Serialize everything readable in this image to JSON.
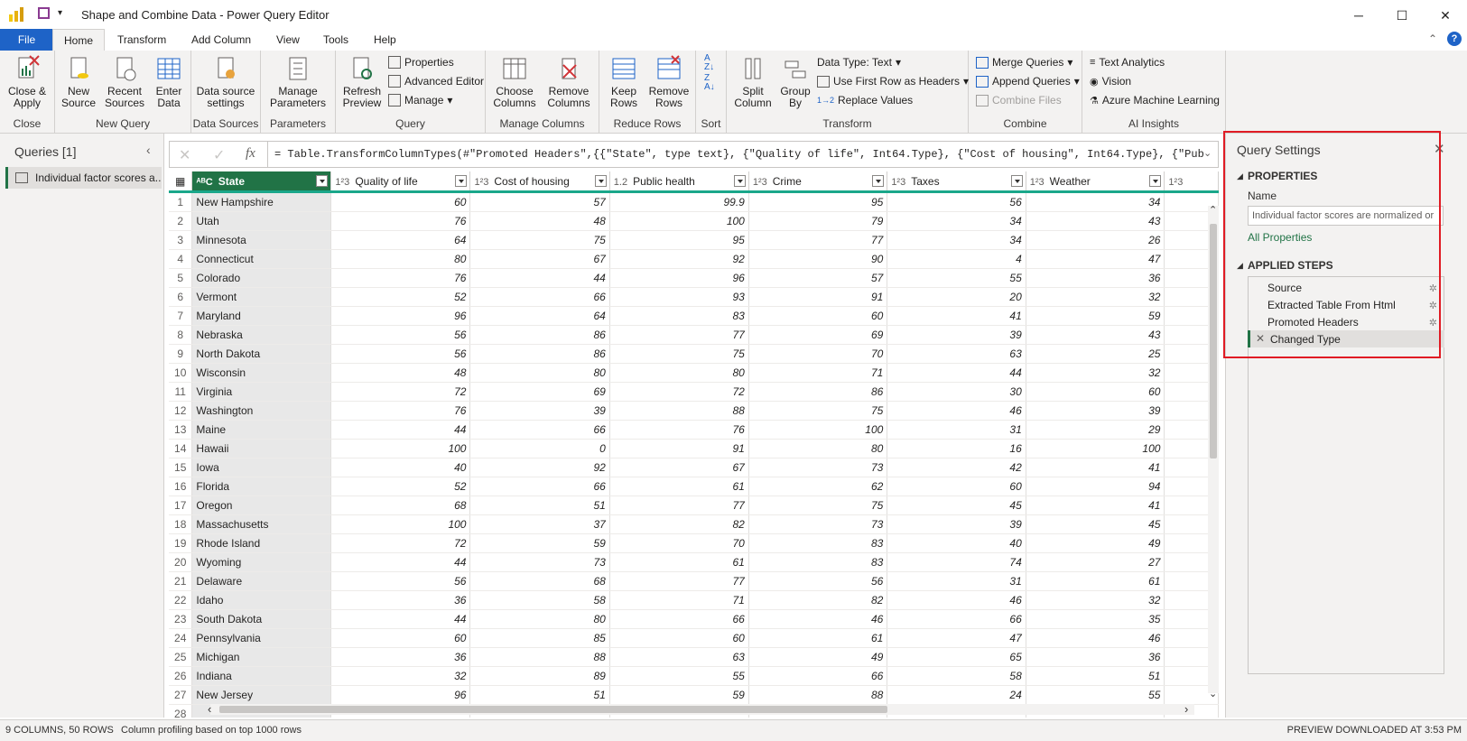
{
  "window": {
    "title": "Shape and Combine Data - Power Query Editor"
  },
  "tabs": [
    "File",
    "Home",
    "Transform",
    "Add Column",
    "View",
    "Tools",
    "Help"
  ],
  "ribbon": {
    "close_apply": "Close &\nApply",
    "close_group": "Close",
    "new_source": "New\nSource",
    "recent_sources": "Recent\nSources",
    "enter_data": "Enter\nData",
    "new_query_group": "New Query",
    "data_source_settings": "Data source\nsettings",
    "data_sources_group": "Data Sources",
    "manage_parameters": "Manage\nParameters",
    "parameters_group": "Parameters",
    "refresh_preview": "Refresh\nPreview",
    "properties": "Properties",
    "advanced_editor": "Advanced Editor",
    "manage": "Manage",
    "query_group": "Query",
    "choose_columns": "Choose\nColumns",
    "remove_columns": "Remove\nColumns",
    "manage_columns_group": "Manage Columns",
    "keep_rows": "Keep\nRows",
    "remove_rows": "Remove\nRows",
    "reduce_rows_group": "Reduce Rows",
    "sort_group": "Sort",
    "split_column": "Split\nColumn",
    "group_by": "Group\nBy",
    "data_type": "Data Type: Text",
    "use_first_row": "Use First Row as Headers",
    "replace_values": "Replace Values",
    "transform_group": "Transform",
    "merge_queries": "Merge Queries",
    "append_queries": "Append Queries",
    "combine_files": "Combine Files",
    "combine_group": "Combine",
    "text_analytics": "Text Analytics",
    "vision": "Vision",
    "azure_ml": "Azure Machine Learning",
    "ai_group": "AI Insights"
  },
  "queries": {
    "header": "Queries [1]",
    "items": [
      "Individual factor scores a..."
    ]
  },
  "formula": "= Table.TransformColumnTypes(#\"Promoted Headers\",{{\"State\", type text}, {\"Quality of life\", Int64.Type}, {\"Cost of housing\", Int64.Type}, {\"Public",
  "columns": [
    {
      "type": "ABC",
      "name": "State"
    },
    {
      "type": "123",
      "name": "Quality of life"
    },
    {
      "type": "123",
      "name": "Cost of housing"
    },
    {
      "type": "1.2",
      "name": "Public health"
    },
    {
      "type": "123",
      "name": "Crime"
    },
    {
      "type": "123",
      "name": "Taxes"
    },
    {
      "type": "123",
      "name": "Weather"
    }
  ],
  "rows": [
    [
      "1",
      "New Hampshire",
      "60",
      "57",
      "99.9",
      "95",
      "56",
      "34"
    ],
    [
      "2",
      "Utah",
      "76",
      "48",
      "100",
      "79",
      "34",
      "43"
    ],
    [
      "3",
      "Minnesota",
      "64",
      "75",
      "95",
      "77",
      "34",
      "26"
    ],
    [
      "4",
      "Connecticut",
      "80",
      "67",
      "92",
      "90",
      "4",
      "47"
    ],
    [
      "5",
      "Colorado",
      "76",
      "44",
      "96",
      "57",
      "55",
      "36"
    ],
    [
      "6",
      "Vermont",
      "52",
      "66",
      "93",
      "91",
      "20",
      "32"
    ],
    [
      "7",
      "Maryland",
      "96",
      "64",
      "83",
      "60",
      "41",
      "59"
    ],
    [
      "8",
      "Nebraska",
      "56",
      "86",
      "77",
      "69",
      "39",
      "43"
    ],
    [
      "9",
      "North Dakota",
      "56",
      "86",
      "75",
      "70",
      "63",
      "25"
    ],
    [
      "10",
      "Wisconsin",
      "48",
      "80",
      "80",
      "71",
      "44",
      "32"
    ],
    [
      "11",
      "Virginia",
      "72",
      "69",
      "72",
      "86",
      "30",
      "60"
    ],
    [
      "12",
      "Washington",
      "76",
      "39",
      "88",
      "75",
      "46",
      "39"
    ],
    [
      "13",
      "Maine",
      "44",
      "66",
      "76",
      "100",
      "31",
      "29"
    ],
    [
      "14",
      "Hawaii",
      "100",
      "0",
      "91",
      "80",
      "16",
      "100"
    ],
    [
      "15",
      "Iowa",
      "40",
      "92",
      "67",
      "73",
      "42",
      "41"
    ],
    [
      "16",
      "Florida",
      "52",
      "66",
      "61",
      "62",
      "60",
      "94"
    ],
    [
      "17",
      "Oregon",
      "68",
      "51",
      "77",
      "75",
      "45",
      "41"
    ],
    [
      "18",
      "Massachusetts",
      "100",
      "37",
      "82",
      "73",
      "39",
      "45"
    ],
    [
      "19",
      "Rhode Island",
      "72",
      "59",
      "70",
      "83",
      "40",
      "49"
    ],
    [
      "20",
      "Wyoming",
      "44",
      "73",
      "61",
      "83",
      "74",
      "27"
    ],
    [
      "21",
      "Delaware",
      "56",
      "68",
      "77",
      "56",
      "31",
      "61"
    ],
    [
      "22",
      "Idaho",
      "36",
      "58",
      "71",
      "82",
      "46",
      "32"
    ],
    [
      "23",
      "South Dakota",
      "44",
      "80",
      "66",
      "46",
      "66",
      "35"
    ],
    [
      "24",
      "Pennsylvania",
      "60",
      "85",
      "60",
      "61",
      "47",
      "46"
    ],
    [
      "25",
      "Michigan",
      "36",
      "88",
      "63",
      "49",
      "65",
      "36"
    ],
    [
      "26",
      "Indiana",
      "32",
      "89",
      "55",
      "66",
      "58",
      "51"
    ],
    [
      "27",
      "New Jersey",
      "96",
      "51",
      "59",
      "88",
      "24",
      "55"
    ],
    [
      "28",
      "",
      "",
      "",
      "",
      "",
      "",
      ""
    ]
  ],
  "settings": {
    "title": "Query Settings",
    "properties_header": "PROPERTIES",
    "name_label": "Name",
    "name_value": "Individual factor scores are normalized or",
    "all_properties": "All Properties",
    "applied_steps_header": "APPLIED STEPS",
    "steps": [
      "Source",
      "Extracted Table From Html",
      "Promoted Headers",
      "Changed Type"
    ]
  },
  "status": {
    "columns_rows": "9 COLUMNS, 50 ROWS",
    "profiling": "Column profiling based on top 1000 rows",
    "preview": "PREVIEW DOWNLOADED AT 3:53 PM"
  },
  "colors": {
    "accent_green": "#217346",
    "file_blue": "#1e63c7",
    "highlight_red": "#e01b24",
    "teal_bar": "#1aa78a"
  }
}
